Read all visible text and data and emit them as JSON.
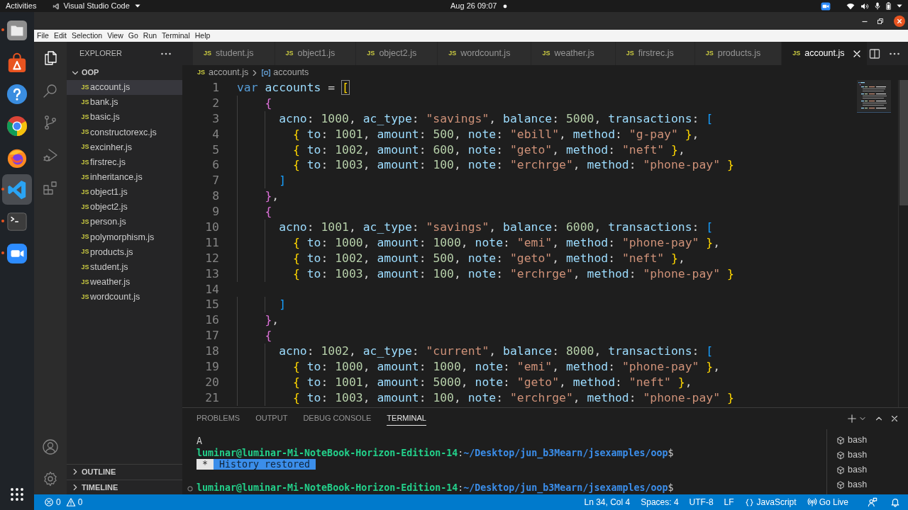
{
  "top_bar": {
    "activities": "Activities",
    "app_name": "Visual Studio Code",
    "clock": "Aug 26 09:07"
  },
  "dock": {
    "apps": [
      {
        "kind": "files",
        "running": true,
        "selected": false
      },
      {
        "kind": "store",
        "running": false,
        "selected": false
      },
      {
        "kind": "help",
        "running": false,
        "selected": false
      },
      {
        "kind": "browser",
        "running": false,
        "selected": false
      },
      {
        "kind": "fox",
        "running": false,
        "selected": false
      },
      {
        "kind": "editor",
        "running": true,
        "selected": true
      },
      {
        "kind": "terminal",
        "running": true,
        "selected": false
      },
      {
        "kind": "camera",
        "running": true,
        "selected": false
      }
    ]
  },
  "menu_bar": [
    "File",
    "Edit",
    "Selection",
    "View",
    "Go",
    "Run",
    "Terminal",
    "Help"
  ],
  "activity_bar": {
    "items": [
      {
        "kind": "explorer",
        "selected": true
      },
      {
        "kind": "search",
        "selected": false
      },
      {
        "kind": "source_control",
        "selected": false
      },
      {
        "kind": "run_debug",
        "selected": false
      },
      {
        "kind": "extensions",
        "selected": false
      }
    ],
    "bottom": [
      {
        "kind": "account"
      },
      {
        "kind": "settings"
      }
    ]
  },
  "sidebar": {
    "title": "EXPLORER",
    "folder": {
      "name": "OOP",
      "expanded": true,
      "files": [
        {
          "badge": "JS",
          "name": "account.js",
          "selected": true
        },
        {
          "badge": "JS",
          "name": "bank.js",
          "selected": false
        },
        {
          "badge": "JS",
          "name": "basic.js",
          "selected": false
        },
        {
          "badge": "JS",
          "name": "constructorexc.js",
          "selected": false
        },
        {
          "badge": "JS",
          "name": "excinher.js",
          "selected": false
        },
        {
          "badge": "JS",
          "name": "firstrec.js",
          "selected": false
        },
        {
          "badge": "JS",
          "name": "inheritance.js",
          "selected": false
        },
        {
          "badge": "JS",
          "name": "object1.js",
          "selected": false
        },
        {
          "badge": "JS",
          "name": "object2.js",
          "selected": false
        },
        {
          "badge": "JS",
          "name": "person.js",
          "selected": false
        },
        {
          "badge": "JS",
          "name": "polymorphism.js",
          "selected": false
        },
        {
          "badge": "JS",
          "name": "products.js",
          "selected": false
        },
        {
          "badge": "JS",
          "name": "student.js",
          "selected": false
        },
        {
          "badge": "JS",
          "name": "weather.js",
          "selected": false
        },
        {
          "badge": "JS",
          "name": "wordcount.js",
          "selected": false
        }
      ]
    },
    "sections": [
      {
        "name": "OUTLINE",
        "expanded": false
      },
      {
        "name": "TIMELINE",
        "expanded": false
      }
    ]
  },
  "tabs": [
    {
      "badge": "JS",
      "name": "student.js",
      "selected": false
    },
    {
      "badge": "JS",
      "name": "object1.js",
      "selected": false
    },
    {
      "badge": "JS",
      "name": "object2.js",
      "selected": false
    },
    {
      "badge": "JS",
      "name": "wordcount.js",
      "selected": false
    },
    {
      "badge": "JS",
      "name": "weather.js",
      "selected": false
    },
    {
      "badge": "JS",
      "name": "firstrec.js",
      "selected": false
    },
    {
      "badge": "JS",
      "name": "products.js",
      "selected": false
    },
    {
      "badge": "JS",
      "name": "account.js",
      "selected": true
    }
  ],
  "breadcrumb": {
    "badge": "JS",
    "file": "account.js",
    "symbol": "accounts"
  },
  "editor": {
    "lines": [
      {
        "number": "1",
        "tokens": [
          {
            "kind": "keyword",
            "text": "var "
          },
          {
            "kind": "variable",
            "text": "accounts"
          },
          {
            "kind": "punct",
            "text": " = "
          },
          {
            "kind": "match",
            "text": "["
          }
        ]
      },
      {
        "number": "2",
        "tokens": [
          {
            "kind": "bracket2",
            "text": "    {"
          }
        ]
      },
      {
        "number": "3",
        "tokens": [
          {
            "kind": "property",
            "text": "      acno"
          },
          {
            "kind": "punct",
            "text": ": "
          },
          {
            "kind": "number",
            "text": "1000"
          },
          {
            "kind": "punct",
            "text": ", "
          },
          {
            "kind": "property",
            "text": "ac_type"
          },
          {
            "kind": "punct",
            "text": ": "
          },
          {
            "kind": "string",
            "text": "\"savings\""
          },
          {
            "kind": "punct",
            "text": ", "
          },
          {
            "kind": "property",
            "text": "balance"
          },
          {
            "kind": "punct",
            "text": ": "
          },
          {
            "kind": "number",
            "text": "5000"
          },
          {
            "kind": "punct",
            "text": ", "
          },
          {
            "kind": "property",
            "text": "transactions"
          },
          {
            "kind": "punct",
            "text": ": "
          },
          {
            "kind": "bracket3",
            "text": "["
          }
        ]
      },
      {
        "number": "4",
        "tokens": [
          {
            "kind": "bracket1",
            "text": "        {"
          },
          {
            "kind": "property",
            "text": " to"
          },
          {
            "kind": "punct",
            "text": ": "
          },
          {
            "kind": "number",
            "text": "1001"
          },
          {
            "kind": "punct",
            "text": ", "
          },
          {
            "kind": "property",
            "text": "amount"
          },
          {
            "kind": "punct",
            "text": ": "
          },
          {
            "kind": "number",
            "text": "500"
          },
          {
            "kind": "punct",
            "text": ", "
          },
          {
            "kind": "property",
            "text": "note"
          },
          {
            "kind": "punct",
            "text": ": "
          },
          {
            "kind": "string",
            "text": "\"ebill\""
          },
          {
            "kind": "punct",
            "text": ", "
          },
          {
            "kind": "property",
            "text": "method"
          },
          {
            "kind": "punct",
            "text": ": "
          },
          {
            "kind": "string",
            "text": "\"g-pay\""
          },
          {
            "kind": "bracket1",
            "text": " }"
          },
          {
            "kind": "punct",
            "text": ","
          }
        ]
      },
      {
        "number": "5",
        "tokens": [
          {
            "kind": "bracket1",
            "text": "        {"
          },
          {
            "kind": "property",
            "text": " to"
          },
          {
            "kind": "punct",
            "text": ": "
          },
          {
            "kind": "number",
            "text": "1002"
          },
          {
            "kind": "punct",
            "text": ", "
          },
          {
            "kind": "property",
            "text": "amount"
          },
          {
            "kind": "punct",
            "text": ": "
          },
          {
            "kind": "number",
            "text": "600"
          },
          {
            "kind": "punct",
            "text": ", "
          },
          {
            "kind": "property",
            "text": "note"
          },
          {
            "kind": "punct",
            "text": ": "
          },
          {
            "kind": "string",
            "text": "\"geto\""
          },
          {
            "kind": "punct",
            "text": ", "
          },
          {
            "kind": "property",
            "text": "method"
          },
          {
            "kind": "punct",
            "text": ": "
          },
          {
            "kind": "string",
            "text": "\"neft\""
          },
          {
            "kind": "bracket1",
            "text": " }"
          },
          {
            "kind": "punct",
            "text": ","
          }
        ]
      },
      {
        "number": "6",
        "tokens": [
          {
            "kind": "bracket1",
            "text": "        {"
          },
          {
            "kind": "property",
            "text": " to"
          },
          {
            "kind": "punct",
            "text": ": "
          },
          {
            "kind": "number",
            "text": "1003"
          },
          {
            "kind": "punct",
            "text": ", "
          },
          {
            "kind": "property",
            "text": "amount"
          },
          {
            "kind": "punct",
            "text": ": "
          },
          {
            "kind": "number",
            "text": "100"
          },
          {
            "kind": "punct",
            "text": ", "
          },
          {
            "kind": "property",
            "text": "note"
          },
          {
            "kind": "punct",
            "text": ": "
          },
          {
            "kind": "string",
            "text": "\"erchrge\""
          },
          {
            "kind": "punct",
            "text": ", "
          },
          {
            "kind": "property",
            "text": "method"
          },
          {
            "kind": "punct",
            "text": ": "
          },
          {
            "kind": "string",
            "text": "\"phone-pay\""
          },
          {
            "kind": "bracket1",
            "text": " }"
          }
        ]
      },
      {
        "number": "7",
        "tokens": [
          {
            "kind": "bracket3",
            "text": "      ]"
          }
        ]
      },
      {
        "number": "8",
        "tokens": [
          {
            "kind": "bracket2",
            "text": "    }"
          },
          {
            "kind": "punct",
            "text": ","
          }
        ]
      },
      {
        "number": "9",
        "tokens": [
          {
            "kind": "bracket2",
            "text": "    {"
          }
        ]
      },
      {
        "number": "10",
        "tokens": [
          {
            "kind": "property",
            "text": "      acno"
          },
          {
            "kind": "punct",
            "text": ": "
          },
          {
            "kind": "number",
            "text": "1001"
          },
          {
            "kind": "punct",
            "text": ", "
          },
          {
            "kind": "property",
            "text": "ac_type"
          },
          {
            "kind": "punct",
            "text": ": "
          },
          {
            "kind": "string",
            "text": "\"savings\""
          },
          {
            "kind": "punct",
            "text": ", "
          },
          {
            "kind": "property",
            "text": "balance"
          },
          {
            "kind": "punct",
            "text": ": "
          },
          {
            "kind": "number",
            "text": "6000"
          },
          {
            "kind": "punct",
            "text": ", "
          },
          {
            "kind": "property",
            "text": "transactions"
          },
          {
            "kind": "punct",
            "text": ": "
          },
          {
            "kind": "bracket3",
            "text": "["
          }
        ]
      },
      {
        "number": "11",
        "tokens": [
          {
            "kind": "bracket1",
            "text": "        {"
          },
          {
            "kind": "property",
            "text": " to"
          },
          {
            "kind": "punct",
            "text": ": "
          },
          {
            "kind": "number",
            "text": "1000"
          },
          {
            "kind": "punct",
            "text": ", "
          },
          {
            "kind": "property",
            "text": "amount"
          },
          {
            "kind": "punct",
            "text": ": "
          },
          {
            "kind": "number",
            "text": "1000"
          },
          {
            "kind": "punct",
            "text": ", "
          },
          {
            "kind": "property",
            "text": "note"
          },
          {
            "kind": "punct",
            "text": ": "
          },
          {
            "kind": "string",
            "text": "\"emi\""
          },
          {
            "kind": "punct",
            "text": ", "
          },
          {
            "kind": "property",
            "text": "method"
          },
          {
            "kind": "punct",
            "text": ": "
          },
          {
            "kind": "string",
            "text": "\"phone-pay\""
          },
          {
            "kind": "bracket1",
            "text": " }"
          },
          {
            "kind": "punct",
            "text": ","
          }
        ]
      },
      {
        "number": "12",
        "tokens": [
          {
            "kind": "bracket1",
            "text": "        {"
          },
          {
            "kind": "property",
            "text": " to"
          },
          {
            "kind": "punct",
            "text": ": "
          },
          {
            "kind": "number",
            "text": "1002"
          },
          {
            "kind": "punct",
            "text": ", "
          },
          {
            "kind": "property",
            "text": "amount"
          },
          {
            "kind": "punct",
            "text": ": "
          },
          {
            "kind": "number",
            "text": "500"
          },
          {
            "kind": "punct",
            "text": ", "
          },
          {
            "kind": "property",
            "text": "note"
          },
          {
            "kind": "punct",
            "text": ": "
          },
          {
            "kind": "string",
            "text": "\"geto\""
          },
          {
            "kind": "punct",
            "text": ", "
          },
          {
            "kind": "property",
            "text": "method"
          },
          {
            "kind": "punct",
            "text": ": "
          },
          {
            "kind": "string",
            "text": "\"neft\""
          },
          {
            "kind": "bracket1",
            "text": " }"
          },
          {
            "kind": "punct",
            "text": ","
          }
        ]
      },
      {
        "number": "13",
        "tokens": [
          {
            "kind": "bracket1",
            "text": "        {"
          },
          {
            "kind": "property",
            "text": " to"
          },
          {
            "kind": "punct",
            "text": ": "
          },
          {
            "kind": "number",
            "text": "1003"
          },
          {
            "kind": "punct",
            "text": ", "
          },
          {
            "kind": "property",
            "text": "amount"
          },
          {
            "kind": "punct",
            "text": ": "
          },
          {
            "kind": "number",
            "text": "100"
          },
          {
            "kind": "punct",
            "text": ", "
          },
          {
            "kind": "property",
            "text": "note"
          },
          {
            "kind": "punct",
            "text": ": "
          },
          {
            "kind": "string",
            "text": "\"erchrge\""
          },
          {
            "kind": "punct",
            "text": ", "
          },
          {
            "kind": "property",
            "text": "method"
          },
          {
            "kind": "punct",
            "text": ": "
          },
          {
            "kind": "string",
            "text": "\"phone-pay\""
          },
          {
            "kind": "bracket1",
            "text": " }"
          }
        ]
      },
      {
        "number": "14"
      },
      {
        "number": "15",
        "tokens": [
          {
            "kind": "bracket3",
            "text": "      ]"
          }
        ]
      },
      {
        "number": "16",
        "tokens": [
          {
            "kind": "bracket2",
            "text": "    }"
          },
          {
            "kind": "punct",
            "text": ","
          }
        ]
      },
      {
        "number": "17",
        "tokens": [
          {
            "kind": "bracket2",
            "text": "    {"
          }
        ]
      },
      {
        "number": "18",
        "tokens": [
          {
            "kind": "property",
            "text": "      acno"
          },
          {
            "kind": "punct",
            "text": ": "
          },
          {
            "kind": "number",
            "text": "1002"
          },
          {
            "kind": "punct",
            "text": ", "
          },
          {
            "kind": "property",
            "text": "ac_type"
          },
          {
            "kind": "punct",
            "text": ": "
          },
          {
            "kind": "string",
            "text": "\"current\""
          },
          {
            "kind": "punct",
            "text": ", "
          },
          {
            "kind": "property",
            "text": "balance"
          },
          {
            "kind": "punct",
            "text": ": "
          },
          {
            "kind": "number",
            "text": "8000"
          },
          {
            "kind": "punct",
            "text": ", "
          },
          {
            "kind": "property",
            "text": "transactions"
          },
          {
            "kind": "punct",
            "text": ": "
          },
          {
            "kind": "bracket3",
            "text": "["
          }
        ]
      },
      {
        "number": "19",
        "tokens": [
          {
            "kind": "bracket1",
            "text": "        {"
          },
          {
            "kind": "property",
            "text": " to"
          },
          {
            "kind": "punct",
            "text": ": "
          },
          {
            "kind": "number",
            "text": "1000"
          },
          {
            "kind": "punct",
            "text": ", "
          },
          {
            "kind": "property",
            "text": "amount"
          },
          {
            "kind": "punct",
            "text": ": "
          },
          {
            "kind": "number",
            "text": "1000"
          },
          {
            "kind": "punct",
            "text": ", "
          },
          {
            "kind": "property",
            "text": "note"
          },
          {
            "kind": "punct",
            "text": ": "
          },
          {
            "kind": "string",
            "text": "\"emi\""
          },
          {
            "kind": "punct",
            "text": ", "
          },
          {
            "kind": "property",
            "text": "method"
          },
          {
            "kind": "punct",
            "text": ": "
          },
          {
            "kind": "string",
            "text": "\"phone-pay\""
          },
          {
            "kind": "bracket1",
            "text": " }"
          },
          {
            "kind": "punct",
            "text": ","
          }
        ]
      },
      {
        "number": "20",
        "tokens": [
          {
            "kind": "bracket1",
            "text": "        {"
          },
          {
            "kind": "property",
            "text": " to"
          },
          {
            "kind": "punct",
            "text": ": "
          },
          {
            "kind": "number",
            "text": "1001"
          },
          {
            "kind": "punct",
            "text": ", "
          },
          {
            "kind": "property",
            "text": "amount"
          },
          {
            "kind": "punct",
            "text": ": "
          },
          {
            "kind": "number",
            "text": "5000"
          },
          {
            "kind": "punct",
            "text": ", "
          },
          {
            "kind": "property",
            "text": "note"
          },
          {
            "kind": "punct",
            "text": ": "
          },
          {
            "kind": "string",
            "text": "\"geto\""
          },
          {
            "kind": "punct",
            "text": ", "
          },
          {
            "kind": "property",
            "text": "method"
          },
          {
            "kind": "punct",
            "text": ": "
          },
          {
            "kind": "string",
            "text": "\"neft\""
          },
          {
            "kind": "bracket1",
            "text": " }"
          },
          {
            "kind": "punct",
            "text": ","
          }
        ]
      },
      {
        "number": "21",
        "tokens": [
          {
            "kind": "bracket1",
            "text": "        {"
          },
          {
            "kind": "property",
            "text": " to"
          },
          {
            "kind": "punct",
            "text": ": "
          },
          {
            "kind": "number",
            "text": "1003"
          },
          {
            "kind": "punct",
            "text": ", "
          },
          {
            "kind": "property",
            "text": "amount"
          },
          {
            "kind": "punct",
            "text": ": "
          },
          {
            "kind": "number",
            "text": "100"
          },
          {
            "kind": "punct",
            "text": ", "
          },
          {
            "kind": "property",
            "text": "note"
          },
          {
            "kind": "punct",
            "text": ": "
          },
          {
            "kind": "string",
            "text": "\"erchrge\""
          },
          {
            "kind": "punct",
            "text": ", "
          },
          {
            "kind": "property",
            "text": "method"
          },
          {
            "kind": "punct",
            "text": ": "
          },
          {
            "kind": "string",
            "text": "\"phone-pay\""
          },
          {
            "kind": "bracket1",
            "text": " }"
          }
        ]
      }
    ]
  },
  "panel": {
    "tabs": [
      {
        "label": "PROBLEMS",
        "selected": false
      },
      {
        "label": "OUTPUT",
        "selected": false
      },
      {
        "label": "DEBUG CONSOLE",
        "selected": false
      },
      {
        "label": "TERMINAL",
        "selected": true
      }
    ],
    "terminal": {
      "lines": [
        {
          "kind": "output",
          "segments": [
            {
              "kind": "plain",
              "text": "A"
            }
          ]
        },
        {
          "kind": "prompt",
          "segments": [
            {
              "kind": "user",
              "text": "luminar@luminar-Mi-NoteBook-Horizon-Edition-14"
            },
            {
              "kind": "plain",
              "text": ":"
            },
            {
              "kind": "path",
              "text": "~/Desktop/jun_b3Mearn/jsexamples/oop"
            },
            {
              "kind": "plain",
              "text": "$"
            }
          ]
        },
        {
          "kind": "output",
          "segments": [
            {
              "kind": "tag",
              "text": "*"
            },
            {
              "kind": "notice",
              "text": "History restored"
            }
          ]
        },
        {
          "kind": "blank"
        },
        {
          "kind": "current",
          "segments": [
            {
              "kind": "user",
              "text": "luminar@luminar-Mi-NoteBook-Horizon-Edition-14"
            },
            {
              "kind": "plain",
              "text": ":"
            },
            {
              "kind": "path",
              "text": "~/Desktop/jun_b3Mearn/jsexamples/oop"
            },
            {
              "kind": "plain",
              "text": "$"
            }
          ]
        }
      ]
    },
    "sessions": [
      {
        "name": "bash"
      },
      {
        "name": "bash"
      },
      {
        "name": "bash"
      },
      {
        "name": "bash"
      }
    ]
  },
  "status_bar": {
    "errors": "0",
    "warnings": "0",
    "items": [
      {
        "kind": "text",
        "text": "Ln 34, Col 4"
      },
      {
        "kind": "text",
        "text": "Spaces: 4"
      },
      {
        "kind": "text",
        "text": "UTF-8"
      },
      {
        "kind": "text",
        "text": "LF"
      },
      {
        "kind": "language",
        "text": "JavaScript"
      },
      {
        "kind": "live",
        "text": "Go Live"
      }
    ]
  }
}
